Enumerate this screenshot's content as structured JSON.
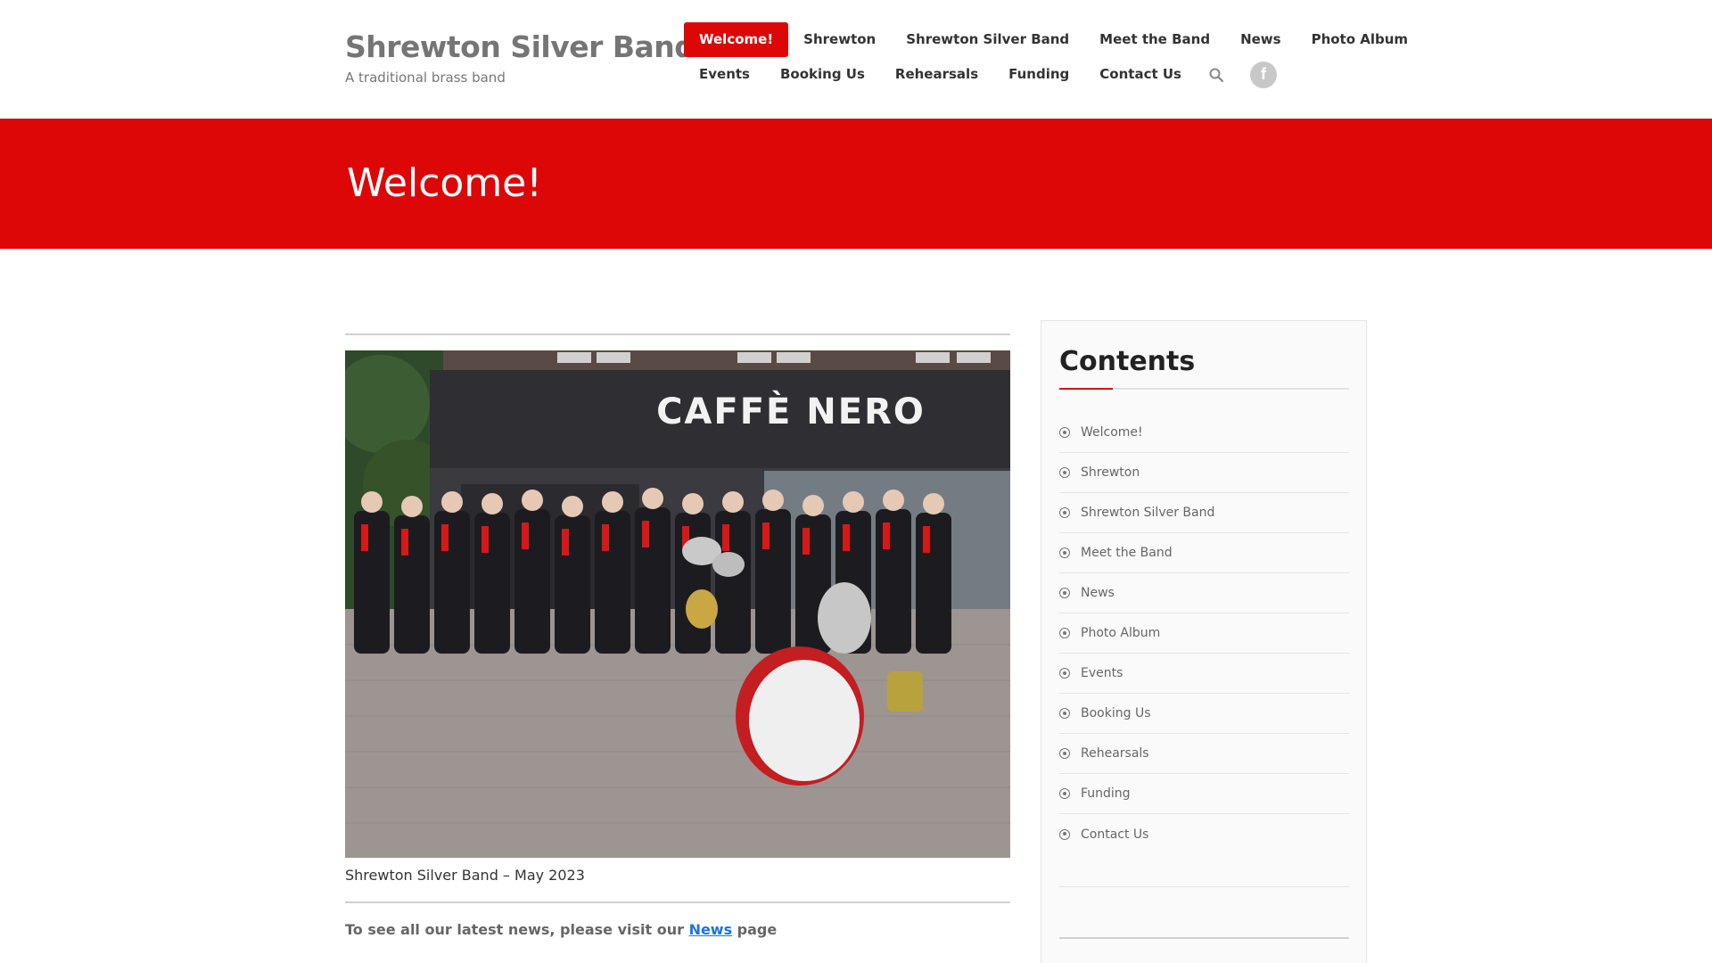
{
  "site": {
    "title": "Shrewton Silver Band",
    "tagline": "A traditional brass band"
  },
  "nav": {
    "row1": [
      {
        "label": "Welcome!",
        "active": true
      },
      {
        "label": "Shrewton"
      },
      {
        "label": "Shrewton Silver Band"
      },
      {
        "label": "Meet the Band"
      },
      {
        "label": "News"
      },
      {
        "label": "Photo Album"
      }
    ],
    "row2": [
      {
        "label": "Events"
      },
      {
        "label": "Booking Us"
      },
      {
        "label": "Rehearsals"
      },
      {
        "label": "Funding"
      },
      {
        "label": "Contact Us"
      }
    ],
    "search_icon": "search-icon",
    "social_icon": "facebook-icon",
    "social_glyph": "f"
  },
  "banner": {
    "title": "Welcome!"
  },
  "main": {
    "photo_sign": "CAFFÈ NERO",
    "caption": "Shrewton Silver Band – May 2023",
    "news_prefix": "To see all our latest news, please visit our ",
    "news_link": "News",
    "news_suffix": " page"
  },
  "sidebar": {
    "title": "Contents",
    "items": [
      {
        "label": "Welcome!"
      },
      {
        "label": "Shrewton"
      },
      {
        "label": "Shrewton Silver Band"
      },
      {
        "label": "Meet the Band"
      },
      {
        "label": "News"
      },
      {
        "label": "Photo Album"
      },
      {
        "label": "Events"
      },
      {
        "label": "Booking Us"
      },
      {
        "label": "Rehearsals"
      },
      {
        "label": "Funding"
      },
      {
        "label": "Contact Us"
      }
    ]
  },
  "colors": {
    "accent": "#dd0707",
    "link": "#1a73e8"
  }
}
